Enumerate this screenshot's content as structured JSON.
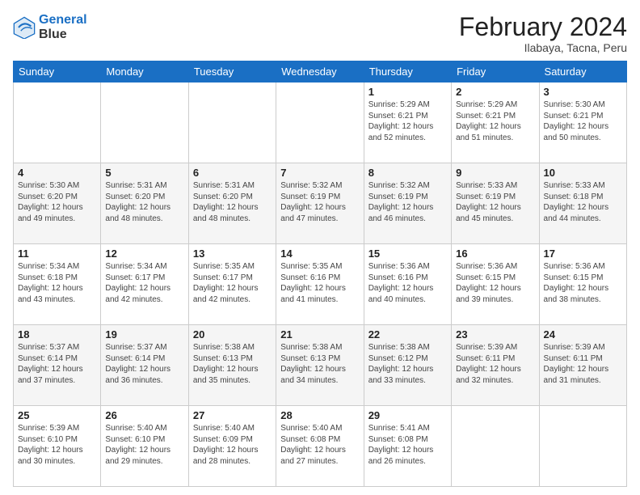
{
  "logo": {
    "text1": "General",
    "text2": "Blue"
  },
  "title": "February 2024",
  "subtitle": "Ilabaya, Tacna, Peru",
  "days_of_week": [
    "Sunday",
    "Monday",
    "Tuesday",
    "Wednesday",
    "Thursday",
    "Friday",
    "Saturday"
  ],
  "weeks": [
    [
      {
        "day": "",
        "info": ""
      },
      {
        "day": "",
        "info": ""
      },
      {
        "day": "",
        "info": ""
      },
      {
        "day": "",
        "info": ""
      },
      {
        "day": "1",
        "info": "Sunrise: 5:29 AM\nSunset: 6:21 PM\nDaylight: 12 hours\nand 52 minutes."
      },
      {
        "day": "2",
        "info": "Sunrise: 5:29 AM\nSunset: 6:21 PM\nDaylight: 12 hours\nand 51 minutes."
      },
      {
        "day": "3",
        "info": "Sunrise: 5:30 AM\nSunset: 6:21 PM\nDaylight: 12 hours\nand 50 minutes."
      }
    ],
    [
      {
        "day": "4",
        "info": "Sunrise: 5:30 AM\nSunset: 6:20 PM\nDaylight: 12 hours\nand 49 minutes."
      },
      {
        "day": "5",
        "info": "Sunrise: 5:31 AM\nSunset: 6:20 PM\nDaylight: 12 hours\nand 48 minutes."
      },
      {
        "day": "6",
        "info": "Sunrise: 5:31 AM\nSunset: 6:20 PM\nDaylight: 12 hours\nand 48 minutes."
      },
      {
        "day": "7",
        "info": "Sunrise: 5:32 AM\nSunset: 6:19 PM\nDaylight: 12 hours\nand 47 minutes."
      },
      {
        "day": "8",
        "info": "Sunrise: 5:32 AM\nSunset: 6:19 PM\nDaylight: 12 hours\nand 46 minutes."
      },
      {
        "day": "9",
        "info": "Sunrise: 5:33 AM\nSunset: 6:19 PM\nDaylight: 12 hours\nand 45 minutes."
      },
      {
        "day": "10",
        "info": "Sunrise: 5:33 AM\nSunset: 6:18 PM\nDaylight: 12 hours\nand 44 minutes."
      }
    ],
    [
      {
        "day": "11",
        "info": "Sunrise: 5:34 AM\nSunset: 6:18 PM\nDaylight: 12 hours\nand 43 minutes."
      },
      {
        "day": "12",
        "info": "Sunrise: 5:34 AM\nSunset: 6:17 PM\nDaylight: 12 hours\nand 42 minutes."
      },
      {
        "day": "13",
        "info": "Sunrise: 5:35 AM\nSunset: 6:17 PM\nDaylight: 12 hours\nand 42 minutes."
      },
      {
        "day": "14",
        "info": "Sunrise: 5:35 AM\nSunset: 6:16 PM\nDaylight: 12 hours\nand 41 minutes."
      },
      {
        "day": "15",
        "info": "Sunrise: 5:36 AM\nSunset: 6:16 PM\nDaylight: 12 hours\nand 40 minutes."
      },
      {
        "day": "16",
        "info": "Sunrise: 5:36 AM\nSunset: 6:15 PM\nDaylight: 12 hours\nand 39 minutes."
      },
      {
        "day": "17",
        "info": "Sunrise: 5:36 AM\nSunset: 6:15 PM\nDaylight: 12 hours\nand 38 minutes."
      }
    ],
    [
      {
        "day": "18",
        "info": "Sunrise: 5:37 AM\nSunset: 6:14 PM\nDaylight: 12 hours\nand 37 minutes."
      },
      {
        "day": "19",
        "info": "Sunrise: 5:37 AM\nSunset: 6:14 PM\nDaylight: 12 hours\nand 36 minutes."
      },
      {
        "day": "20",
        "info": "Sunrise: 5:38 AM\nSunset: 6:13 PM\nDaylight: 12 hours\nand 35 minutes."
      },
      {
        "day": "21",
        "info": "Sunrise: 5:38 AM\nSunset: 6:13 PM\nDaylight: 12 hours\nand 34 minutes."
      },
      {
        "day": "22",
        "info": "Sunrise: 5:38 AM\nSunset: 6:12 PM\nDaylight: 12 hours\nand 33 minutes."
      },
      {
        "day": "23",
        "info": "Sunrise: 5:39 AM\nSunset: 6:11 PM\nDaylight: 12 hours\nand 32 minutes."
      },
      {
        "day": "24",
        "info": "Sunrise: 5:39 AM\nSunset: 6:11 PM\nDaylight: 12 hours\nand 31 minutes."
      }
    ],
    [
      {
        "day": "25",
        "info": "Sunrise: 5:39 AM\nSunset: 6:10 PM\nDaylight: 12 hours\nand 30 minutes."
      },
      {
        "day": "26",
        "info": "Sunrise: 5:40 AM\nSunset: 6:10 PM\nDaylight: 12 hours\nand 29 minutes."
      },
      {
        "day": "27",
        "info": "Sunrise: 5:40 AM\nSunset: 6:09 PM\nDaylight: 12 hours\nand 28 minutes."
      },
      {
        "day": "28",
        "info": "Sunrise: 5:40 AM\nSunset: 6:08 PM\nDaylight: 12 hours\nand 27 minutes."
      },
      {
        "day": "29",
        "info": "Sunrise: 5:41 AM\nSunset: 6:08 PM\nDaylight: 12 hours\nand 26 minutes."
      },
      {
        "day": "",
        "info": ""
      },
      {
        "day": "",
        "info": ""
      }
    ]
  ]
}
